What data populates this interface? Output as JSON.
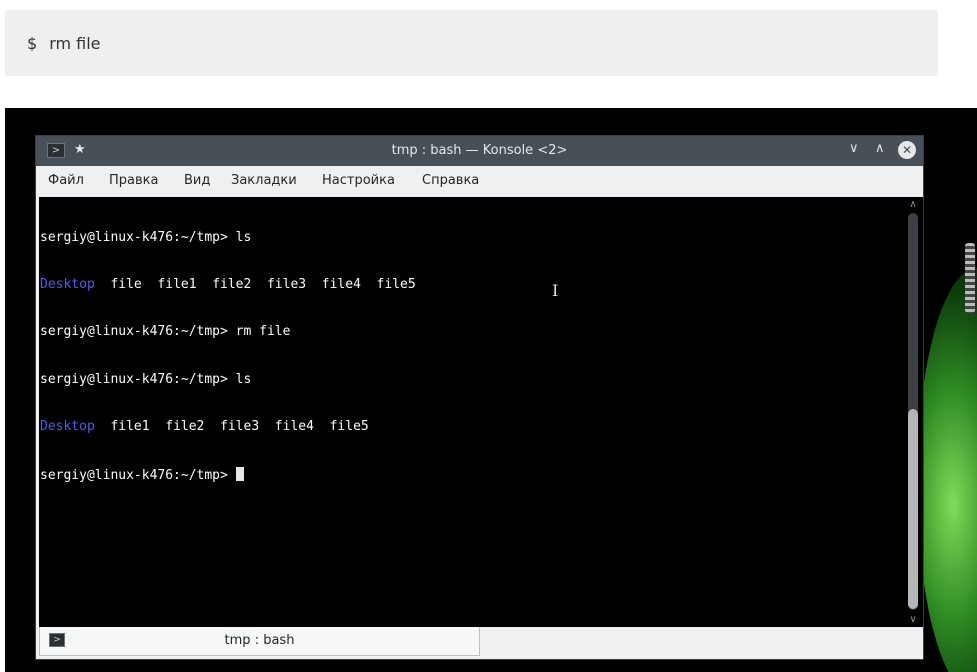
{
  "code_snippet": {
    "prompt": "$",
    "command": "rm file"
  },
  "window": {
    "title": "tmp : bash — Konsole <2>",
    "app_icon": "terminal-icon",
    "controls": [
      "pin-icon",
      "minimize-icon",
      "maximize-icon",
      "close-icon"
    ]
  },
  "menu": {
    "items": [
      "Файл",
      "Правка",
      "Вид",
      "Закладки",
      "Настройка",
      "Справка"
    ]
  },
  "terminal": {
    "lines": [
      {
        "prompt": "sergiy@linux-k476:~/tmp> ",
        "command": "ls"
      },
      {
        "dir": "Desktop",
        "rest": "  file  file1  file2  file3  file4  file5"
      },
      {
        "prompt": "sergiy@linux-k476:~/tmp> ",
        "command": "rm file"
      },
      {
        "prompt": "sergiy@linux-k476:~/tmp> ",
        "command": "ls"
      },
      {
        "dir": "Desktop",
        "rest": "  file1  file2  file3  file4  file5"
      },
      {
        "prompt": "sergiy@linux-k476:~/tmp> ",
        "command": ""
      }
    ],
    "colors": {
      "background": "#000000",
      "text": "#fcfcfc",
      "directory": "#4a5cf0"
    }
  },
  "tabs": [
    {
      "label": "tmp : bash"
    }
  ]
}
